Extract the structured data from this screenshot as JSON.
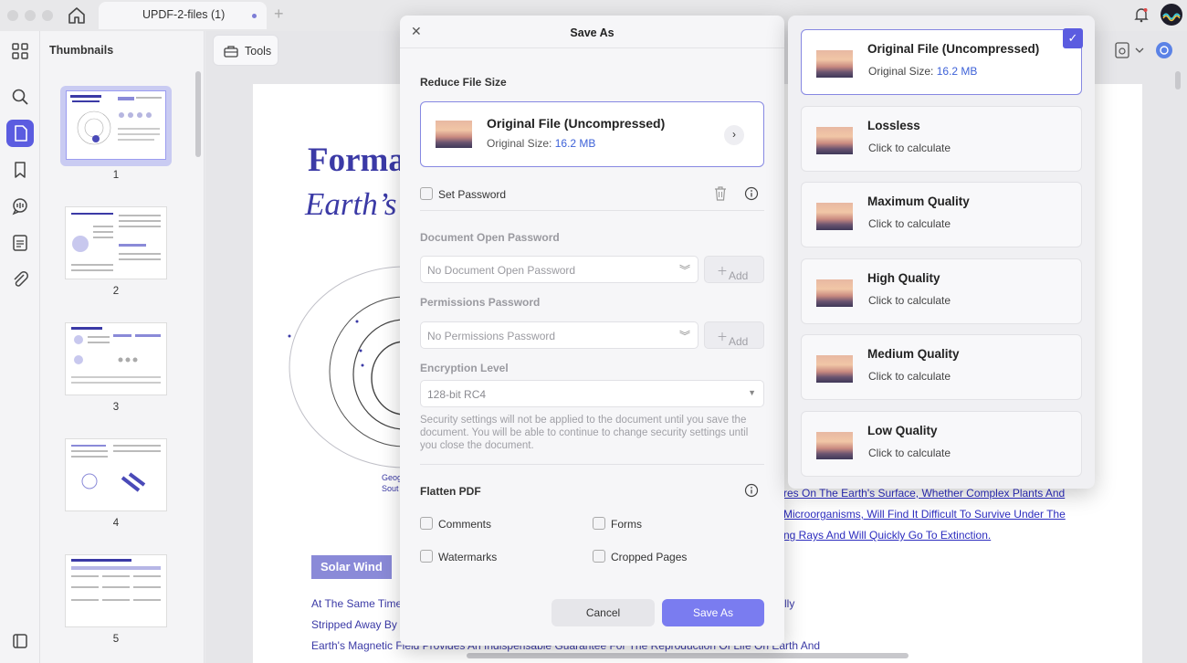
{
  "app": {
    "tab_title": "UPDF-2-files (1)",
    "tab_plus": "+"
  },
  "thumbnails": {
    "title": "Thumbnails",
    "pages": [
      "1",
      "2",
      "3",
      "4",
      "5"
    ]
  },
  "toolbar": {
    "tools_label": "Tools"
  },
  "document": {
    "title_line1": "Forma",
    "title_line2": "Earth’s",
    "geog_line1": "Geog",
    "geog_line2": "Sout",
    "section_badge": "Solar Wind",
    "para_line1": "At The Same Time,",
    "para_line2": "Stripped Away By F",
    "para_line3": "Earth's Magnetic Field Provides An Indispensable Guarantee For The Reproduction Of Life On Earth And",
    "link_line1": "res On The Earth's Surface, Whether Complex Plants And",
    "link_line2": "Microorganisms, Will Find It Difficult To Survive Under The",
    "link_line3": "ng Rays And Will Quickly Go To Extinction.",
    "side_fragment": "lly"
  },
  "save_dialog": {
    "title": "Save As",
    "reduce_label": "Reduce File Size",
    "file_card": {
      "name": "Original File (Uncompressed)",
      "size_prefix": "Original Size:",
      "size_value": "16.2 MB"
    },
    "set_password_label": "Set Password",
    "open_password_label": "Document Open Password",
    "open_password_placeholder": "No Document Open Password",
    "permissions_label": "Permissions Password",
    "permissions_placeholder": "No Permissions Password",
    "add_label": "Add",
    "encryption_label": "Encryption Level",
    "encryption_value": "128-bit RC4",
    "security_note": "Security settings will not be applied to the document until you save the document. You will be able to continue to change security settings until you close the document.",
    "flatten_label": "Flatten PDF",
    "flatten_options": [
      "Comments",
      "Forms",
      "Watermarks",
      "Cropped Pages"
    ],
    "cancel_label": "Cancel",
    "save_label": "Save As"
  },
  "quality_panel": {
    "options": [
      {
        "name": "Original File (Uncompressed)",
        "sub_prefix": "Original Size:",
        "sub_value": "16.2 MB",
        "selected": true
      },
      {
        "name": "Lossless",
        "sub_prefix": "Click to calculate",
        "sub_value": "",
        "selected": false
      },
      {
        "name": "Maximum Quality",
        "sub_prefix": "Click to calculate",
        "sub_value": "",
        "selected": false
      },
      {
        "name": "High Quality",
        "sub_prefix": "Click to calculate",
        "sub_value": "",
        "selected": false
      },
      {
        "name": "Medium Quality",
        "sub_prefix": "Click to calculate",
        "sub_value": "",
        "selected": false
      },
      {
        "name": "Low Quality",
        "sub_prefix": "Click to calculate",
        "sub_value": "",
        "selected": false
      }
    ]
  },
  "colors": {
    "accent": "#5b5ce0",
    "accent_light": "#7a7cf0",
    "document_blue": "#3b3aa6",
    "size_blue": "#3e62d8"
  }
}
